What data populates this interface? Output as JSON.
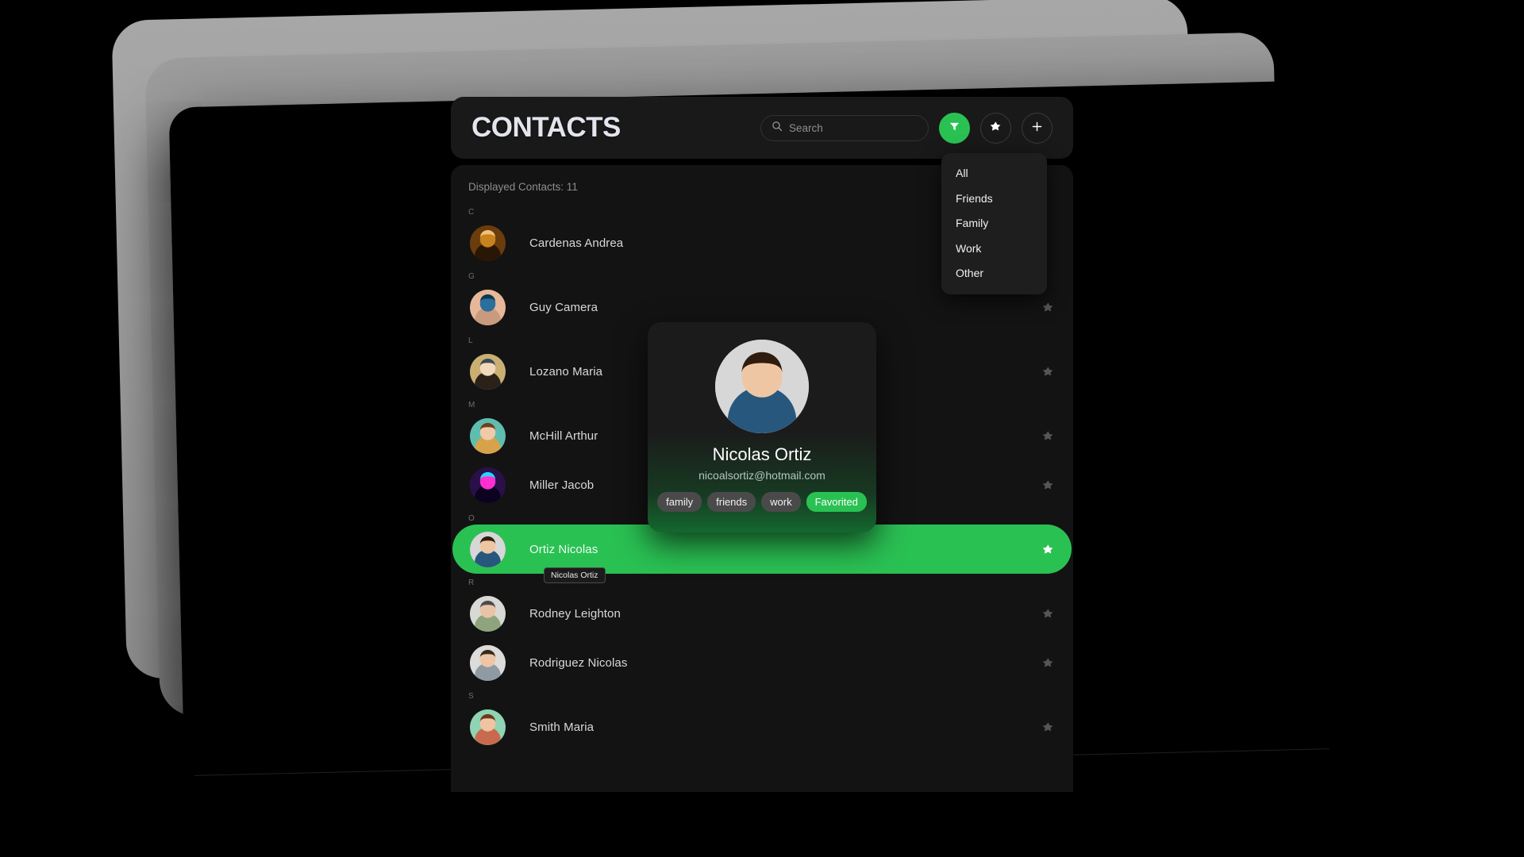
{
  "header": {
    "title": "CONTACTS",
    "search": {
      "value": "",
      "placeholder": "Search"
    },
    "buttons": [
      {
        "name": "filter-button",
        "icon": "funnel-icon",
        "accent": "#2ac153"
      },
      {
        "name": "favorites-button",
        "icon": "star-icon"
      },
      {
        "name": "add-contact-button",
        "icon": "plus-icon"
      }
    ]
  },
  "filter_menu": {
    "visible": true,
    "items": [
      "All",
      "Friends",
      "Family",
      "Work",
      "Other"
    ]
  },
  "list": {
    "displayed_count_label": "Displayed Contacts: 11",
    "sections": [
      {
        "letter": "C",
        "rows": [
          {
            "name": "Cardenas Andrea",
            "starred": false,
            "selected": false,
            "avatar": "woman-autumn-leaves",
            "star_hidden": true
          }
        ]
      },
      {
        "letter": "G",
        "rows": [
          {
            "name": "Guy Camera",
            "starred": false,
            "selected": false,
            "avatar": "person-with-camera"
          }
        ]
      },
      {
        "letter": "L",
        "rows": [
          {
            "name": "Lozano Maria",
            "starred": false,
            "selected": false,
            "avatar": "woman-outdoors"
          }
        ]
      },
      {
        "letter": "M",
        "rows": [
          {
            "name": "McHill Arthur",
            "starred": false,
            "selected": false,
            "avatar": "man-glasses-teal"
          },
          {
            "name": "Miller Jacob",
            "starred": false,
            "selected": false,
            "avatar": "neon-cyber-person"
          }
        ]
      },
      {
        "letter": "O",
        "rows": [
          {
            "name": "Ortiz Nicolas",
            "starred": true,
            "selected": true,
            "avatar": "man-blue-polo",
            "tooltip": "Nicolas Ortiz"
          }
        ]
      },
      {
        "letter": "R",
        "rows": [
          {
            "name": "Rodney Leighton",
            "starred": false,
            "selected": false,
            "avatar": "photographer-hat"
          },
          {
            "name": "Rodriguez Nicolas",
            "starred": false,
            "selected": false,
            "avatar": "man-grey-shirt"
          }
        ]
      },
      {
        "letter": "S",
        "rows": [
          {
            "name": "Smith Maria",
            "starred": false,
            "selected": false,
            "avatar": "woman-curly-smiling"
          }
        ]
      }
    ]
  },
  "contact_card": {
    "name": "Nicolas Ortiz",
    "email": "nicoalsortiz@hotmail.com",
    "avatar": "man-blue-polo",
    "tags": [
      "family",
      "friends",
      "work"
    ],
    "favorite_label": "Favorited"
  },
  "colors": {
    "accent_green": "#2ac153",
    "panel_bg": "#131313",
    "header_bg": "#191919",
    "menu_bg": "#1e1e1e",
    "text_primary": "#d8d8d8",
    "text_muted": "#8d8d8d"
  }
}
